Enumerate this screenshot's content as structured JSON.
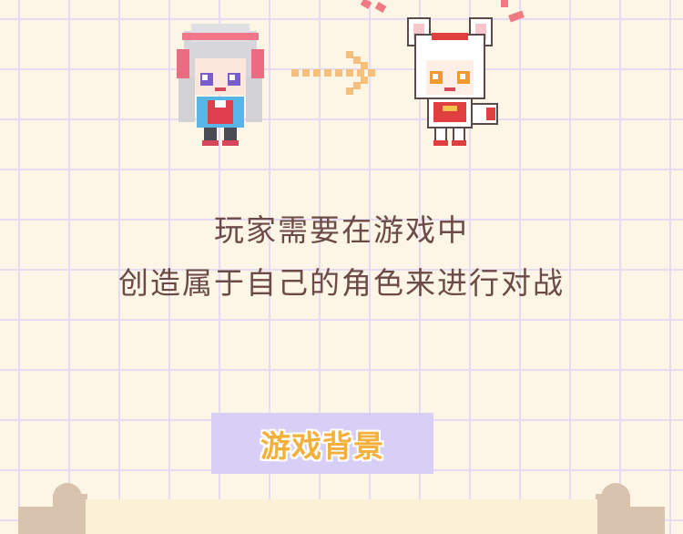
{
  "intro": {
    "line1": "玩家需要在游戏中",
    "line2": "创造属于自己的角色来进行对战"
  },
  "section_button": {
    "label": "游戏背景"
  },
  "colors": {
    "background": "#fdf6e6",
    "grid": "#e5dcf3",
    "text": "#6b4a47",
    "button_bg": "#d8cff6",
    "button_text": "#f4b03a",
    "arrow": "#f6c07c",
    "sparks": "#f07a84",
    "scroll": "#fbf0d5",
    "scroll_end": "#d8c3ae"
  },
  "icons": {
    "left_character": "headphone-girl-pixel-icon",
    "arrow": "dotted-right-arrow-icon",
    "right_character": "fox-girl-pixel-icon",
    "sparks": "sparkle-marks-icon"
  }
}
